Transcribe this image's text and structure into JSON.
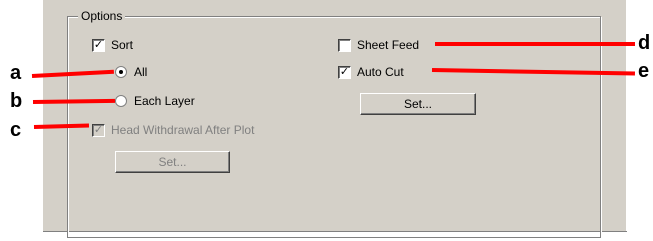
{
  "group": {
    "title": "Options"
  },
  "controls": {
    "sort": {
      "label": "Sort",
      "checked": true
    },
    "all": {
      "label": "All",
      "selected": true
    },
    "each_layer": {
      "label": "Each Layer",
      "selected": false
    },
    "head_withdrawal": {
      "label": "Head Withdrawal After Plot",
      "checked": true,
      "disabled": true
    },
    "set_left": {
      "label": "Set...",
      "disabled": true
    },
    "sheet_feed": {
      "label": "Sheet Feed",
      "checked": false
    },
    "auto_cut": {
      "label": "Auto Cut",
      "checked": true
    },
    "set_right": {
      "label": "Set..."
    }
  },
  "callouts": {
    "a": "a",
    "b": "b",
    "c": "c",
    "d": "d",
    "e": "e"
  },
  "colors": {
    "pointer": "#ff0000",
    "dialog_bg": "#d4d0c8"
  }
}
